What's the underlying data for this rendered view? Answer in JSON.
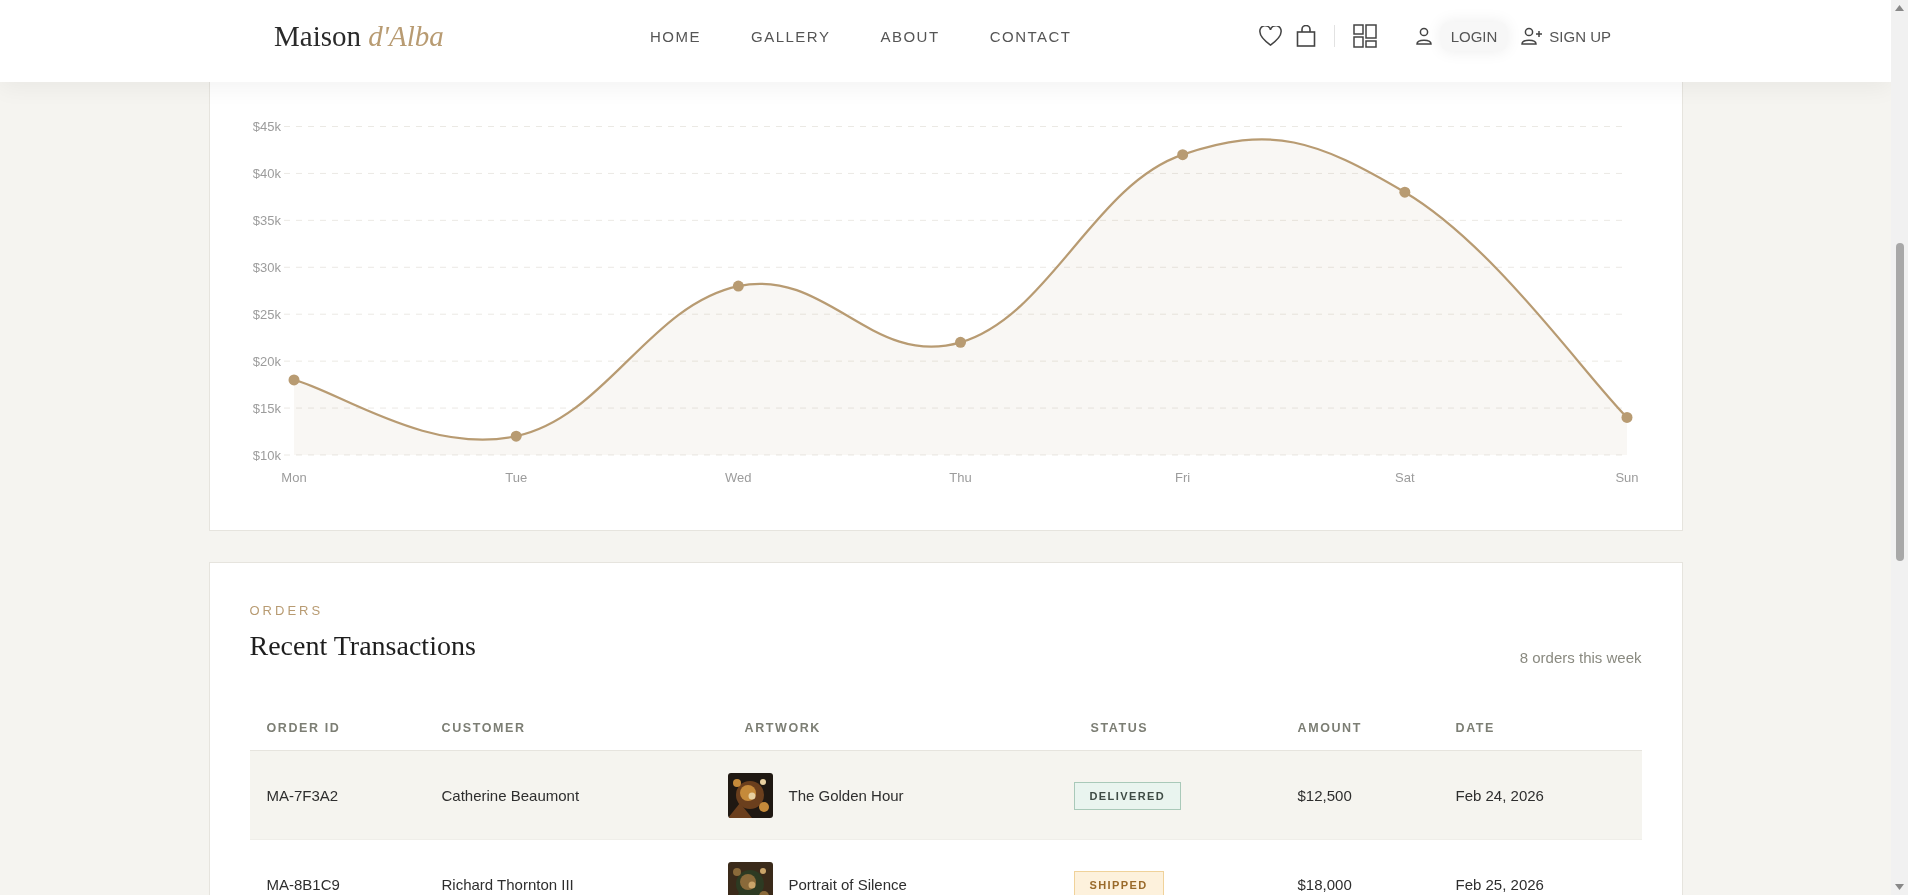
{
  "header": {
    "logo": {
      "name": "Maison",
      "accent": "d'Alba"
    },
    "nav": [
      {
        "label": "HOME"
      },
      {
        "label": "GALLERY"
      },
      {
        "label": "ABOUT"
      },
      {
        "label": "CONTACT"
      }
    ],
    "login": "LOGIN",
    "signup": "SIGN UP"
  },
  "performance": {
    "chart_data": {
      "type": "area",
      "categories": [
        "Mon",
        "Tue",
        "Wed",
        "Thu",
        "Fri",
        "Sat",
        "Sun"
      ],
      "grid": true,
      "series": [
        {
          "color": "#b89b72",
          "values": [
            18000,
            12000,
            28000,
            22000,
            42000,
            38000,
            14000
          ]
        }
      ],
      "ylim": [
        10000,
        45000
      ],
      "yticks": [
        {
          "value": 10000,
          "label": "$10k"
        },
        {
          "value": 15000,
          "label": "$15k"
        },
        {
          "value": 20000,
          "label": "$20k"
        },
        {
          "value": 25000,
          "label": "$25k"
        },
        {
          "value": 30000,
          "label": "$30k"
        },
        {
          "value": 35000,
          "label": "$35k"
        },
        {
          "value": 40000,
          "label": "$40k"
        },
        {
          "value": 45000,
          "label": "$45k"
        }
      ]
    }
  },
  "orders": {
    "eyebrow": "ORDERS",
    "title": "Recent Transactions",
    "summary": "8 orders this week",
    "columns": [
      "ORDER ID",
      "CUSTOMER",
      "ARTWORK",
      "STATUS",
      "AMOUNT",
      "DATE"
    ],
    "rows": [
      {
        "order_id": "MA-7F3A2",
        "customer": "Catherine Beaumont",
        "artwork": "The Golden Hour",
        "status": {
          "label": "DELIVERED",
          "kind": "delivered"
        },
        "amount": "$12,500",
        "date": "Feb 24, 2026",
        "highlighted": true
      },
      {
        "order_id": "MA-8B1C9",
        "customer": "Richard Thornton III",
        "artwork": "Portrait of Silence",
        "status": {
          "label": "SHIPPED",
          "kind": "shipped"
        },
        "amount": "$18,000",
        "date": "Feb 25, 2026",
        "highlighted": false
      }
    ]
  }
}
